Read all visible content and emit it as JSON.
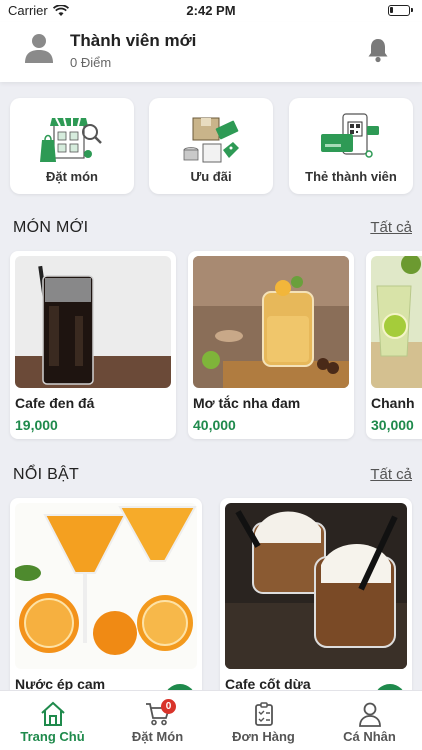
{
  "status_bar": {
    "carrier": "Carrier",
    "time": "2:42 PM",
    "battery_level": 0.2
  },
  "header": {
    "user_name": "Thành viên mới",
    "points": "0 Điểm"
  },
  "quick_actions": [
    {
      "label": "Đặt món",
      "icon": "store-icon"
    },
    {
      "label": "Ưu đãi",
      "icon": "voucher-icon"
    },
    {
      "label": "Thẻ thành viên",
      "icon": "member-card-icon"
    }
  ],
  "new_items": {
    "title": "MÓN MỚI",
    "see_all": "Tất cả",
    "items": [
      {
        "name": "Cafe đen đá",
        "price": "19,000"
      },
      {
        "name": "Mơ tắc nha đam",
        "price": "40,000"
      },
      {
        "name": "Chanh",
        "price": "30,000"
      }
    ]
  },
  "featured": {
    "title": "NỔI BẬT",
    "see_all": "Tất cả",
    "items": [
      {
        "name": "Nước ép cam"
      },
      {
        "name": "Cafe cốt dừa"
      }
    ]
  },
  "tabbar": {
    "tabs": [
      {
        "label": "Trang Chủ",
        "icon": "home-icon",
        "active": true
      },
      {
        "label": "Đặt Món",
        "icon": "cart-icon",
        "badge": "0"
      },
      {
        "label": "Đơn Hàng",
        "icon": "order-list-icon"
      },
      {
        "label": "Cá Nhân",
        "icon": "user-icon"
      }
    ]
  },
  "colors": {
    "accent": "#1f8a4c",
    "badge": "#d9342b",
    "background": "#edeef3"
  }
}
